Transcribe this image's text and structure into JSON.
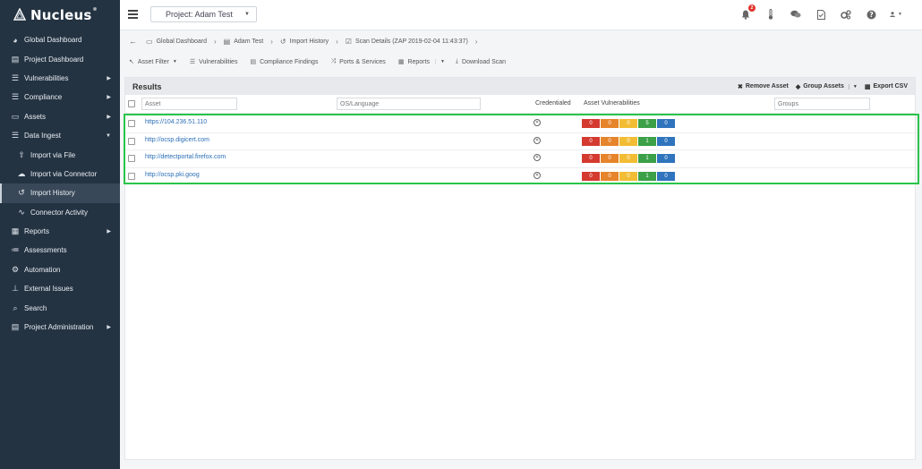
{
  "app": {
    "name": "Nucleus"
  },
  "topbar": {
    "project_label": "Project: Adam Test",
    "notification_count": "2"
  },
  "sidebar": {
    "items": [
      {
        "label": "Global Dashboard",
        "icon": "palette-icon",
        "caret": false,
        "sub": false,
        "active": false
      },
      {
        "label": "Project Dashboard",
        "icon": "dashboard-icon",
        "caret": false,
        "sub": false,
        "active": false
      },
      {
        "label": "Vulnerabilities",
        "icon": "list-icon",
        "caret": true,
        "sub": false,
        "active": false
      },
      {
        "label": "Compliance",
        "icon": "list-icon",
        "caret": true,
        "sub": false,
        "active": false
      },
      {
        "label": "Assets",
        "icon": "monitor-icon",
        "caret": true,
        "sub": false,
        "active": false
      },
      {
        "label": "Data Ingest",
        "icon": "menu-icon",
        "caret": true,
        "sub": false,
        "active": false
      },
      {
        "label": "Import via File",
        "icon": "upload-icon",
        "caret": false,
        "sub": true,
        "active": false
      },
      {
        "label": "Import via Connector",
        "icon": "cloud-upload-icon",
        "caret": false,
        "sub": true,
        "active": false
      },
      {
        "label": "Import History",
        "icon": "history-icon",
        "caret": false,
        "sub": true,
        "active": true
      },
      {
        "label": "Connector Activity",
        "icon": "pulse-icon",
        "caret": false,
        "sub": true,
        "active": false
      },
      {
        "label": "Reports",
        "icon": "grid-icon",
        "caret": true,
        "sub": false,
        "active": false
      },
      {
        "label": "Assessments",
        "icon": "checklist-icon",
        "caret": false,
        "sub": false,
        "active": false
      },
      {
        "label": "Automation",
        "icon": "robot-icon",
        "caret": false,
        "sub": false,
        "active": false
      },
      {
        "label": "External Issues",
        "icon": "sitemap-icon",
        "caret": false,
        "sub": false,
        "active": false
      },
      {
        "label": "Search",
        "icon": "search-icon",
        "caret": false,
        "sub": false,
        "active": false
      },
      {
        "label": "Project Administration",
        "icon": "table-icon",
        "caret": true,
        "sub": false,
        "active": false
      }
    ]
  },
  "breadcrumb": {
    "items": [
      {
        "label": "Global Dashboard",
        "icon": "folder-icon"
      },
      {
        "label": "Adam Test",
        "icon": "dashboard-icon"
      },
      {
        "label": "Import History",
        "icon": "history-icon"
      },
      {
        "label": "Scan Details (ZAP 2019-02-04 11:43:37)",
        "icon": "checkbox-icon"
      }
    ]
  },
  "toolbar": {
    "asset_filter": "Asset Filter",
    "vulnerabilities": "Vulnerabilities",
    "compliance_findings": "Compliance Findings",
    "ports_services": "Ports & Services",
    "reports": "Reports",
    "download_scan": "Download Scan"
  },
  "results": {
    "title": "Results",
    "remove_asset": "Remove Asset",
    "group_assets": "Group Assets",
    "export_csv": "Export CSV",
    "filters": {
      "asset_placeholder": "Asset",
      "os_placeholder": "OS/Language",
      "groups_placeholder": "Groups"
    },
    "columns": {
      "credentialed": "Credentialed",
      "asset_vulnerabilities": "Asset Vulnerabilities"
    },
    "rows": [
      {
        "asset": "https://104.236.51.110",
        "counts": [
          "0",
          "0",
          "0",
          "5",
          "0"
        ]
      },
      {
        "asset": "http://ocsp.digicert.com",
        "counts": [
          "0",
          "0",
          "0",
          "1",
          "0"
        ]
      },
      {
        "asset": "http://detectportal.firefox.com",
        "counts": [
          "0",
          "0",
          "0",
          "1",
          "0"
        ]
      },
      {
        "asset": "http://ocsp.pki.goog",
        "counts": [
          "0",
          "0",
          "0",
          "1",
          "0"
        ]
      }
    ]
  },
  "colors": {
    "sidebar_bg": "#243342",
    "highlight": "#29c44a",
    "critical": "#d43a2f",
    "high": "#e6842b",
    "medium": "#f2bd34",
    "low": "#3ba047",
    "info": "#2f74bd"
  }
}
